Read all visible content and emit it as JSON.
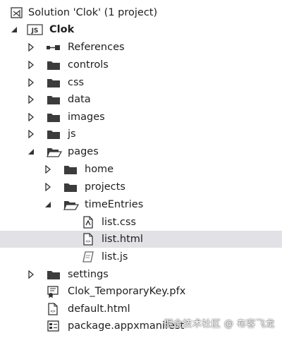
{
  "solution": {
    "label": "Solution 'Clok' (1 project)"
  },
  "project": {
    "label": "Clok",
    "badge": "JS"
  },
  "items": {
    "references": "References",
    "controls": "controls",
    "css": "css",
    "data": "data",
    "images": "images",
    "js": "js",
    "pages": "pages",
    "home": "home",
    "projects": "projects",
    "timeEntries": "timeEntries",
    "list_css": "list.css",
    "list_html": "list.html",
    "list_js": "list.js",
    "settings": "settings",
    "pfx": "Clok_TemporaryKey.pfx",
    "default_html": "default.html",
    "manifest": "package.appxmanifest"
  },
  "watermark": "掘金技术社区 @ 布客飞龙",
  "colors": {
    "selection": "#e1e1e6",
    "folder": "#3c3c3c",
    "text": "#1e1e1e"
  }
}
